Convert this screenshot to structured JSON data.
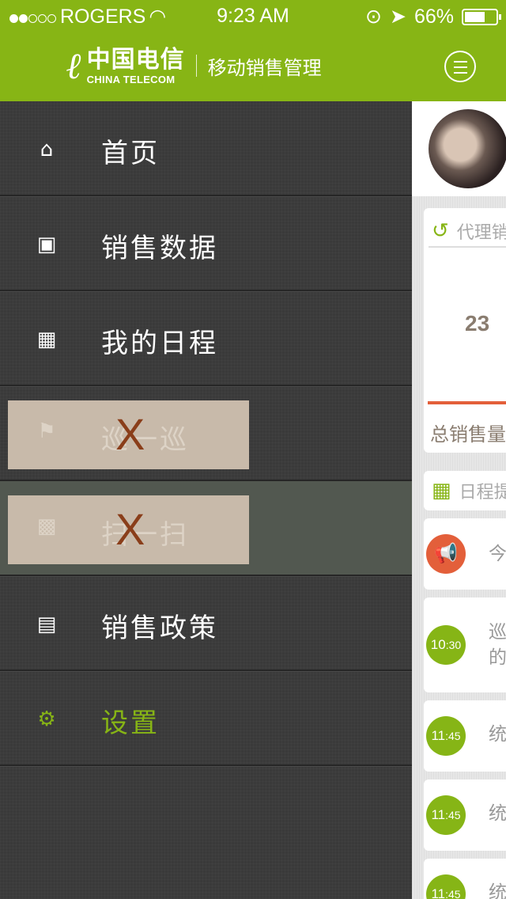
{
  "status": {
    "carrier": "ROGERS",
    "time": "9:23 AM",
    "battery": "66%",
    "signal_bars": 2
  },
  "header": {
    "brand_mark": "ℓ",
    "brand_cn": "中国电信",
    "brand_en": "CHINA TELECOM",
    "subtitle": "移动销售管理"
  },
  "menu": [
    {
      "label": "首页",
      "icon": "home-icon"
    },
    {
      "label": "销售数据",
      "icon": "presentation-icon"
    },
    {
      "label": "我的日程",
      "icon": "calendar-icon"
    },
    {
      "label": "巡一巡",
      "icon": "flag-icon",
      "disabled": true
    },
    {
      "label": "扫一扫",
      "icon": "qr-scan-icon",
      "disabled": true
    },
    {
      "label": "销售政策",
      "icon": "newspaper-icon"
    },
    {
      "label": "设置",
      "icon": "gear-icon"
    }
  ],
  "disabled_mark": "X",
  "main": {
    "sales_card": {
      "title": "代理销",
      "value": "23",
      "footer": "总销售量"
    },
    "schedule_card": {
      "title": "日程提"
    },
    "items": [
      {
        "time": "",
        "text": "今"
      },
      {
        "time_h": "10",
        "time_m": ":30",
        "text": "巡",
        "text2": "的"
      },
      {
        "time_h": "11",
        "time_m": ":45",
        "text": "统"
      },
      {
        "time_h": "11",
        "time_m": ":45",
        "text": "统"
      },
      {
        "time_h": "11",
        "time_m": ":45",
        "text": "统"
      }
    ]
  },
  "colors": {
    "brand_green": "#87b515",
    "accent_orange": "#e35f3a"
  }
}
